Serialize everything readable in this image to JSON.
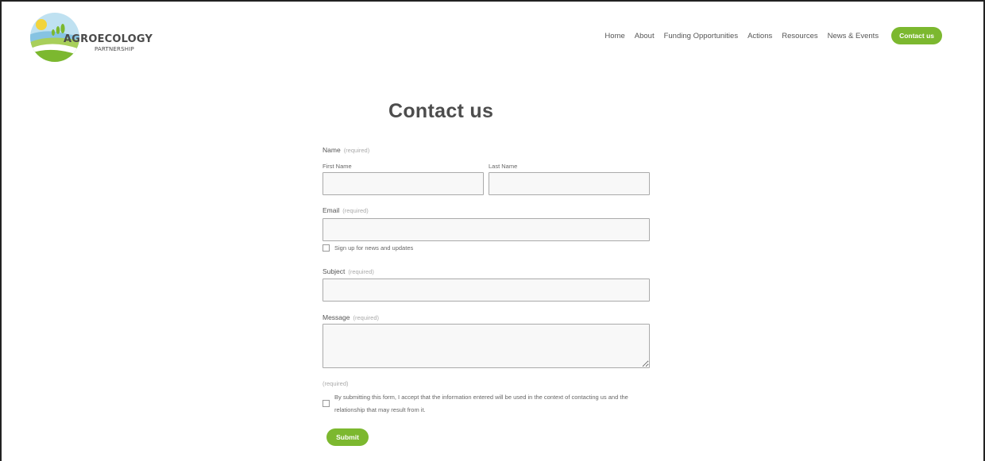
{
  "header": {
    "logo": {
      "title": "AGROECOLOGY",
      "subtitle": "PARTNERSHIP",
      "colors": {
        "green": "#7cb82f",
        "blue": "#86c3e2",
        "sun": "#f2d43c"
      }
    },
    "nav": [
      {
        "label": "Home"
      },
      {
        "label": "About"
      },
      {
        "label": "Funding Opportunities"
      },
      {
        "label": "Actions"
      },
      {
        "label": "Resources"
      },
      {
        "label": "News & Events"
      }
    ],
    "cta_label": "Contact us",
    "accent_color": "#7cb82f"
  },
  "form": {
    "title": "Contact us",
    "name": {
      "label": "Name",
      "required": "(required)",
      "first_label": "First Name",
      "first_value": "",
      "last_label": "Last Name",
      "last_value": ""
    },
    "email": {
      "label": "Email",
      "required": "(required)",
      "value": ""
    },
    "newsletter_label": "Sign up for news and updates",
    "subject": {
      "label": "Subject",
      "required": "(required)",
      "value": ""
    },
    "message": {
      "label": "Message",
      "required": "(required)",
      "value": ""
    },
    "consent_required": "(required)",
    "consent_text": "By submitting this form, I accept that the information entered will be used in the context of contacting us and the relationship that may result from it.",
    "submit_label": "Submit"
  }
}
